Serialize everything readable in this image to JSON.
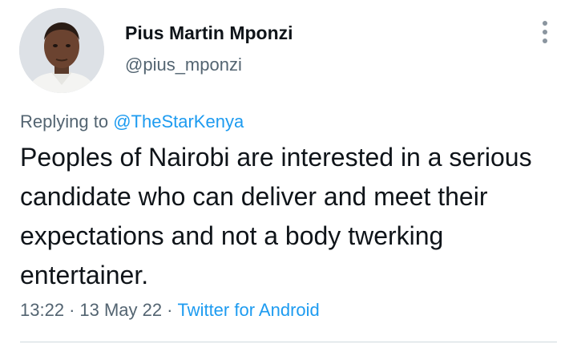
{
  "author": {
    "display_name": "Pius Martin Mponzi",
    "handle": "@pius_mponzi",
    "avatar": "profile-photo"
  },
  "reply": {
    "prefix": "Replying to",
    "mention": "@TheStarKenya"
  },
  "tweet": {
    "text": "Peoples of Nairobi are interested in a serious candidate who can deliver and meet their expectations and not a body twerking entertainer."
  },
  "meta": {
    "time": "13:22",
    "separator": "·",
    "date": "13 May 22",
    "source": "Twitter for Android"
  },
  "icons": {
    "more": "more-options-icon"
  },
  "colors": {
    "text": "#0f1419",
    "secondary": "#536471",
    "link": "#1d9bf0",
    "divider": "#cfd9de"
  }
}
